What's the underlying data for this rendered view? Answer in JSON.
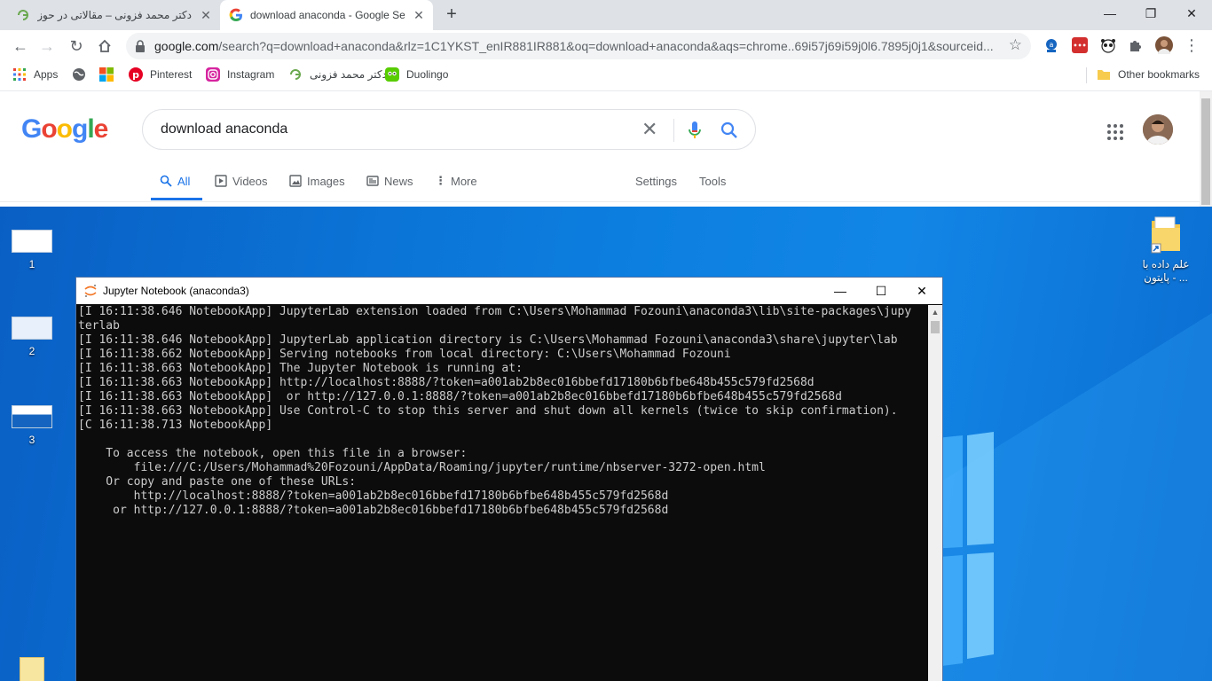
{
  "browser": {
    "tabs": [
      {
        "title": "دکتر محمد فزونی – مقالاتی در حوزه‌های مه",
        "active": false
      },
      {
        "title": "download anaconda - Google Se",
        "active": true
      }
    ],
    "new_tab": "+",
    "window_controls": {
      "minimize": "—",
      "maximize": "❐",
      "close": "✕"
    },
    "url": {
      "host": "google.com",
      "rest": "/search?q=download+anaconda&rlz=1C1YKST_enIR881IR881&oq=download+anaconda&aqs=chrome..69i57j69i59j0l6.7895j0j1&sourceid..."
    },
    "bookmarks": [
      {
        "label": "Apps",
        "icon": "apps-grid-icon"
      },
      {
        "label": "",
        "icon": "globe-icon"
      },
      {
        "label": "",
        "icon": "windows-logo-icon"
      },
      {
        "label": "Pinterest",
        "icon": "pinterest-icon"
      },
      {
        "label": "Instagram",
        "icon": "instagram-icon"
      },
      {
        "label": "دکتر محمد فزونی",
        "icon": "site-icon"
      },
      {
        "label": "Duolingo",
        "icon": "duolingo-icon"
      }
    ],
    "other_bookmarks": "Other bookmarks"
  },
  "google": {
    "logo": "Google",
    "query": "download anaconda",
    "tabs": [
      {
        "label": "All",
        "selected": true
      },
      {
        "label": "Videos"
      },
      {
        "label": "Images"
      },
      {
        "label": "News"
      },
      {
        "label": "More"
      }
    ],
    "settings": "Settings",
    "tools": "Tools"
  },
  "desktop": {
    "thumbnails": [
      {
        "label": "1"
      },
      {
        "label": "2"
      },
      {
        "label": "3"
      }
    ],
    "folder": {
      "line1": "علم داده با",
      "line2": "... - پایتون"
    }
  },
  "console": {
    "title": "Jupyter Notebook (anaconda3)",
    "lines": [
      "[I 16:11:38.646 NotebookApp] JupyterLab extension loaded from C:\\Users\\Mohammad Fozouni\\anaconda3\\lib\\site-packages\\jupy",
      "terlab",
      "[I 16:11:38.646 NotebookApp] JupyterLab application directory is C:\\Users\\Mohammad Fozouni\\anaconda3\\share\\jupyter\\lab",
      "[I 16:11:38.662 NotebookApp] Serving notebooks from local directory: C:\\Users\\Mohammad Fozouni",
      "[I 16:11:38.663 NotebookApp] The Jupyter Notebook is running at:",
      "[I 16:11:38.663 NotebookApp] http://localhost:8888/?token=a001ab2b8ec016bbefd17180b6bfbe648b455c579fd2568d",
      "[I 16:11:38.663 NotebookApp]  or http://127.0.0.1:8888/?token=a001ab2b8ec016bbefd17180b6bfbe648b455c579fd2568d",
      "[I 16:11:38.663 NotebookApp] Use Control-C to stop this server and shut down all kernels (twice to skip confirmation).",
      "[C 16:11:38.713 NotebookApp]",
      "",
      "    To access the notebook, open this file in a browser:",
      "        file:///C:/Users/Mohammad%20Fozouni/AppData/Roaming/jupyter/runtime/nbserver-3272-open.html",
      "    Or copy and paste one of these URLs:",
      "        http://localhost:8888/?token=a001ab2b8ec016bbefd17180b6bfbe648b455c579fd2568d",
      "     or http://127.0.0.1:8888/?token=a001ab2b8ec016bbefd17180b6bfbe648b455c579fd2568d"
    ]
  },
  "colors": {
    "google_blue": "#4285F4",
    "google_red": "#EA4335",
    "google_yellow": "#FBBC05",
    "google_green": "#34A853",
    "desktop_blue": "#0b74d6",
    "terminal_bg": "#0c0c0c",
    "terminal_fg": "#cccccc"
  }
}
